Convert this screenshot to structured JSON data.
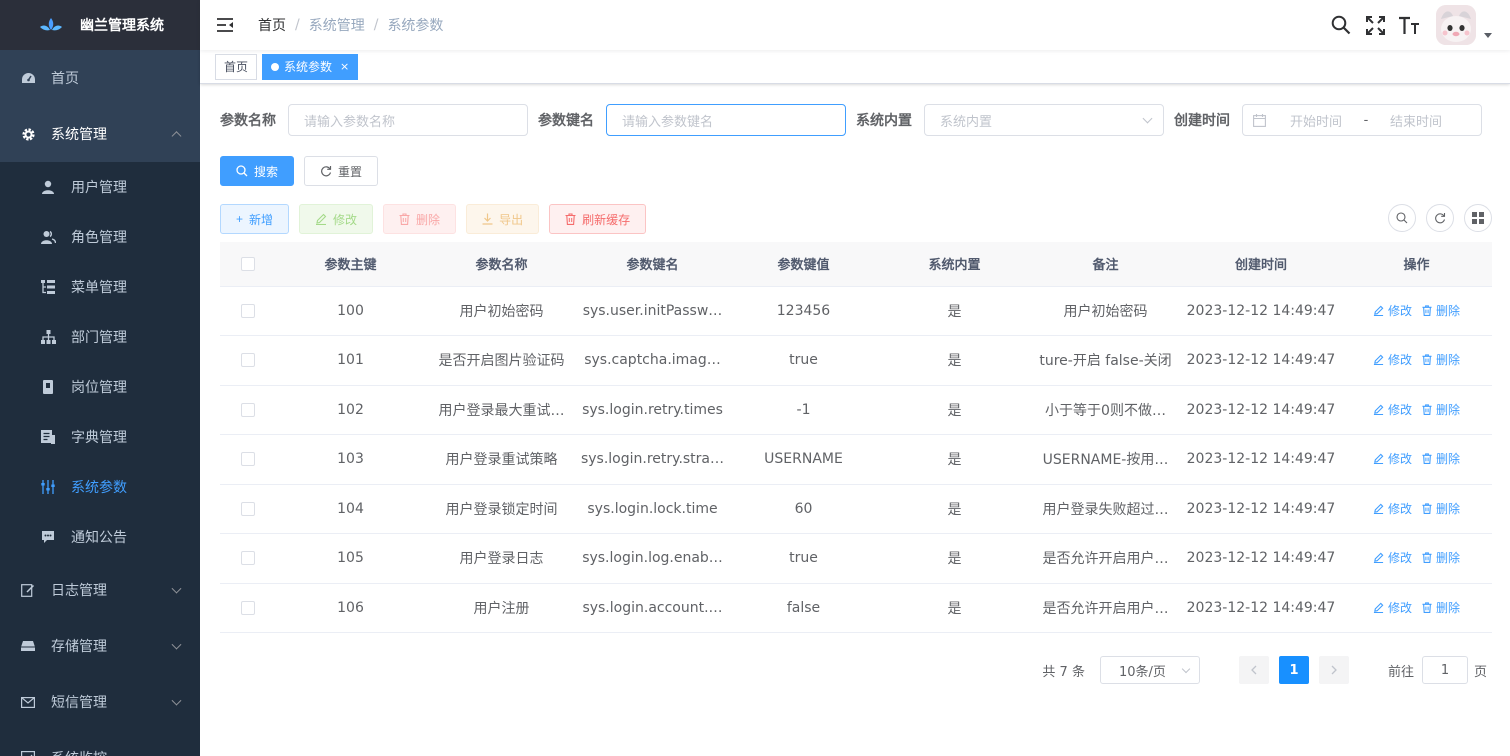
{
  "app": {
    "title": "幽兰管理系统"
  },
  "sidebar": {
    "home": "首页",
    "system": "系统管理",
    "system_children": [
      "用户管理",
      "角色管理",
      "菜单管理",
      "部门管理",
      "岗位管理",
      "字典管理",
      "系统参数",
      "通知公告"
    ],
    "log": "日志管理",
    "storage": "存储管理",
    "sms": "短信管理",
    "monitor": "系统监控"
  },
  "breadcrumb": [
    "首页",
    "系统管理",
    "系统参数"
  ],
  "tags": [
    {
      "label": "首页"
    },
    {
      "label": "系统参数",
      "close": "×"
    }
  ],
  "search": {
    "name_label": "参数名称",
    "name_placeholder": "请输入参数名称",
    "key_label": "参数键名",
    "key_placeholder": "请输入参数键名",
    "builtin_label": "系统内置",
    "builtin_placeholder": "系统内置",
    "time_label": "创建时间",
    "start_placeholder": "开始时间",
    "range_sep": "-",
    "end_placeholder": "结束时间",
    "search_btn": "搜索",
    "reset_btn": "重置"
  },
  "toolbar": {
    "add": "新增",
    "edit": "修改",
    "delete": "删除",
    "export": "导出",
    "refresh_cache": "刷新缓存"
  },
  "table": {
    "headers": [
      "参数主键",
      "参数名称",
      "参数键名",
      "参数键值",
      "系统内置",
      "备注",
      "创建时间",
      "操作"
    ],
    "rows": [
      {
        "id": "100",
        "name": "用户初始密码",
        "key": "sys.user.initPassw…",
        "value": "123456",
        "builtin": "是",
        "remark": "用户初始密码",
        "time": "2023-12-12 14:49:47"
      },
      {
        "id": "101",
        "name": "是否开启图片验证码",
        "key": "sys.captcha.imag…",
        "value": "true",
        "builtin": "是",
        "remark": "ture-开启 false-关闭",
        "time": "2023-12-12 14:49:47"
      },
      {
        "id": "102",
        "name": "用户登录最大重试…",
        "key": "sys.login.retry.times",
        "value": "-1",
        "builtin": "是",
        "remark": "小于等于0则不做…",
        "time": "2023-12-12 14:49:47"
      },
      {
        "id": "103",
        "name": "用户登录重试策略",
        "key": "sys.login.retry.stra…",
        "value": "USERNAME",
        "builtin": "是",
        "remark": "USERNAME-按用…",
        "time": "2023-12-12 14:49:47"
      },
      {
        "id": "104",
        "name": "用户登录锁定时间",
        "key": "sys.login.lock.time",
        "value": "60",
        "builtin": "是",
        "remark": "用户登录失败超过…",
        "time": "2023-12-12 14:49:47"
      },
      {
        "id": "105",
        "name": "用户登录日志",
        "key": "sys.login.log.enab…",
        "value": "true",
        "builtin": "是",
        "remark": "是否允许开启用户…",
        "time": "2023-12-12 14:49:47"
      },
      {
        "id": "106",
        "name": "用户注册",
        "key": "sys.login.account.…",
        "value": "false",
        "builtin": "是",
        "remark": "是否允许开启用户…",
        "time": "2023-12-12 14:49:47"
      }
    ],
    "op_edit": "修改",
    "op_delete": "删除"
  },
  "pagination": {
    "total": "共 7 条",
    "page_size": "10条/页",
    "current": "1",
    "goto_label": "前往",
    "goto_value": "1",
    "page_unit": "页"
  },
  "colors": {
    "accent": "#409eff",
    "sidebar_bg": "#304156",
    "submenu_bg": "#1f2d3d"
  }
}
